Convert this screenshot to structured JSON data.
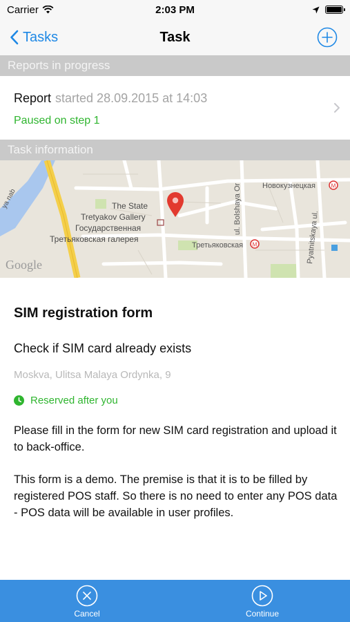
{
  "status_bar": {
    "carrier": "Carrier",
    "time": "2:03 PM"
  },
  "nav": {
    "back_label": "Tasks",
    "title": "Task",
    "add_icon": "plus-circle-icon"
  },
  "sections": {
    "reports_in_progress": "Reports in progress",
    "task_information": "Task information"
  },
  "report": {
    "title": "Report",
    "started": "started 28.09.2015 at 14:03",
    "status": "Paused on step 1"
  },
  "map": {
    "labels": {
      "gallery_line1": "The State",
      "gallery_line2": "Tretyakov Gallery",
      "gallery_ru1": "Государственная",
      "gallery_ru2": "Третьяковская галерея",
      "metro1": "Новокузнецкая",
      "metro2": "Третьяковская",
      "street1": "ul. Bolshaya Or",
      "street2": "Pyatnitskaya ul.",
      "street3": "ya nab",
      "google": "Google"
    }
  },
  "task": {
    "title": "SIM registration form",
    "subtitle": "Check if SIM card already exists",
    "address": "Moskva, Ulitsa Malaya Ordynka, 9",
    "reserved": "Reserved after you",
    "description1": "Please fill in the form for new SIM card registration and upload it to back-office.",
    "description2": "This form is a demo. The premise is that it is to be filled by registered POS staff. So there is no need to enter any POS data - POS data will be available in user profiles."
  },
  "toolbar": {
    "cancel_label": "Cancel",
    "continue_label": "Continue"
  },
  "colors": {
    "accent": "#1e88e5",
    "toolbar": "#3a8fe0",
    "success": "#2fb52f",
    "section_header": "#c9c9c9"
  }
}
